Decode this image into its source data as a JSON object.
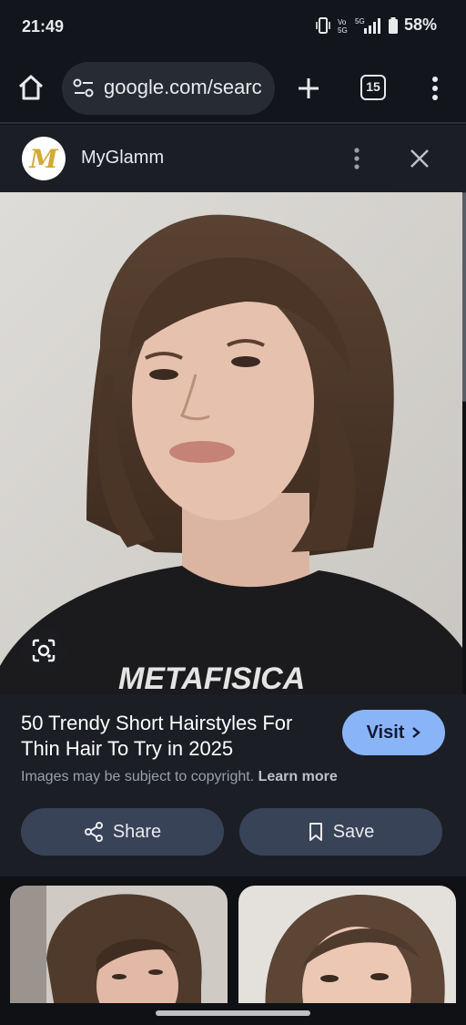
{
  "status_bar": {
    "time": "21:49",
    "battery_percent": "58%",
    "network_label": "5G",
    "volte_label": "Vo 5G"
  },
  "browser": {
    "url_text": "google.com/searc",
    "tab_count": "15"
  },
  "source": {
    "name": "MyGlamm",
    "logo_letter": "M"
  },
  "result": {
    "title": "50 Trendy Short Hairstyles For Thin Hair To Try in 2025",
    "visit_label": "Visit",
    "copyright_text": "Images may be subject to copyright.",
    "learn_more_label": "Learn more",
    "share_label": "Share",
    "save_label": "Save",
    "shirt_text": "METAFISICA"
  },
  "colors": {
    "accent": "#8ab4f8",
    "panel": "#1b1e25",
    "button": "#394357"
  }
}
